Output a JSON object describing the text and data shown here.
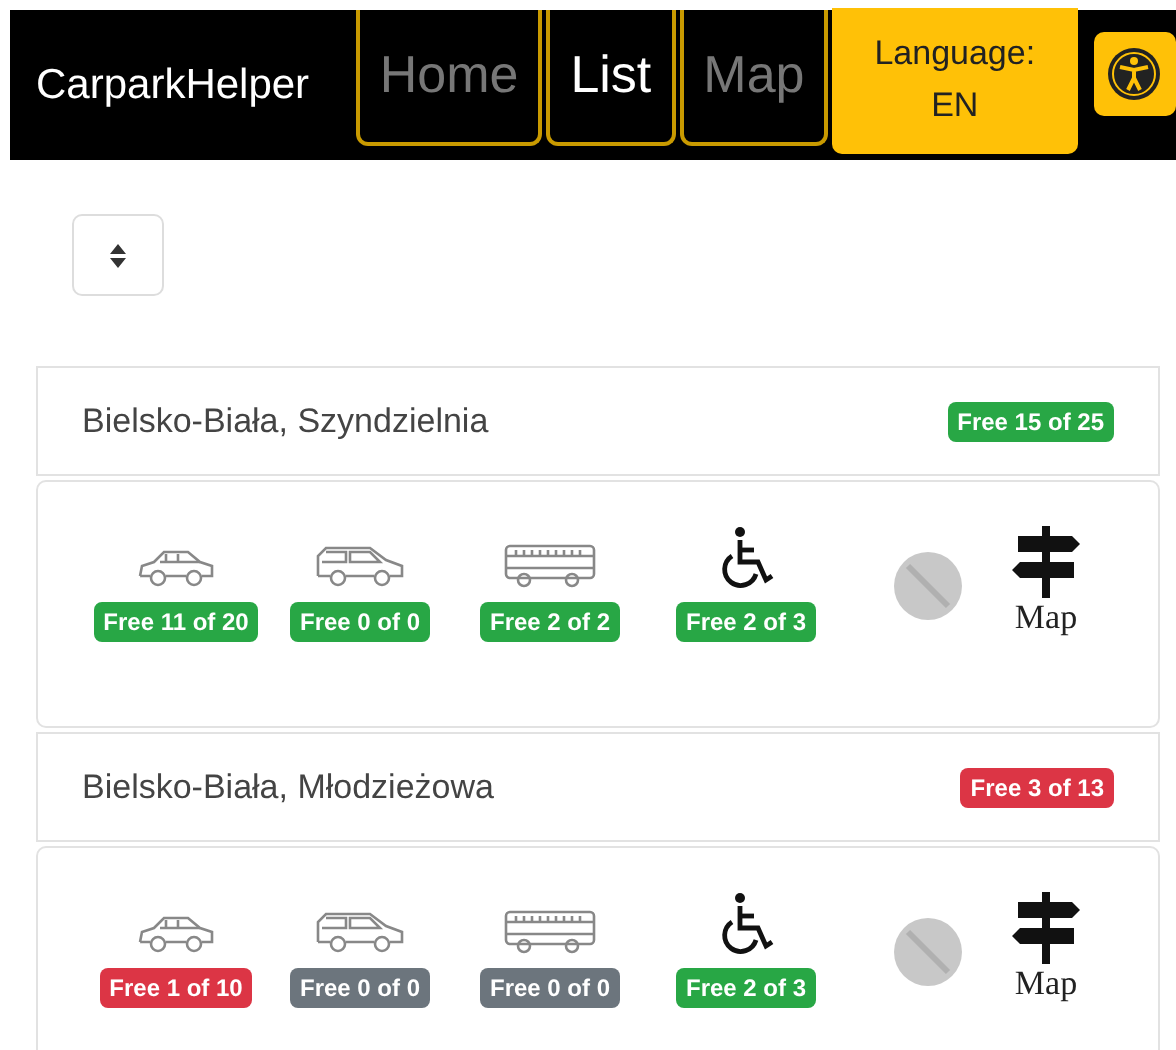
{
  "navbar": {
    "brand": "CarparkHelper",
    "links": [
      {
        "label": "Home",
        "selected": false
      },
      {
        "label": "List",
        "selected": true
      },
      {
        "label": "Map",
        "selected": false
      }
    ],
    "language": {
      "label": "Language:",
      "value": "EN"
    }
  },
  "carparks": [
    {
      "name": "Bielsko-Biała, Szyndzielnia",
      "total": {
        "text": "Free 15 of 25",
        "color": "#28a745"
      },
      "slots": [
        {
          "kind": "car",
          "text": "Free 11 of 20",
          "color": "#28a745"
        },
        {
          "kind": "van",
          "text": "Free 0 of 0",
          "color": "#28a745"
        },
        {
          "kind": "bus",
          "text": "Free 2 of 2",
          "color": "#28a745"
        },
        {
          "kind": "disabled",
          "text": "Free 2 of 3",
          "color": "#28a745"
        }
      ],
      "map_label": "Map"
    },
    {
      "name": "Bielsko-Biała, Młodzieżowa",
      "total": {
        "text": "Free 3 of 13",
        "color": "#dc3545"
      },
      "slots": [
        {
          "kind": "car",
          "text": "Free 1 of 10",
          "color": "#dc3545"
        },
        {
          "kind": "van",
          "text": "Free 0 of 0",
          "color": "#6c757d"
        },
        {
          "kind": "bus",
          "text": "Free 0 of 0",
          "color": "#6c757d"
        },
        {
          "kind": "disabled",
          "text": "Free 2 of 3",
          "color": "#28a745"
        }
      ],
      "map_label": "Map"
    }
  ]
}
